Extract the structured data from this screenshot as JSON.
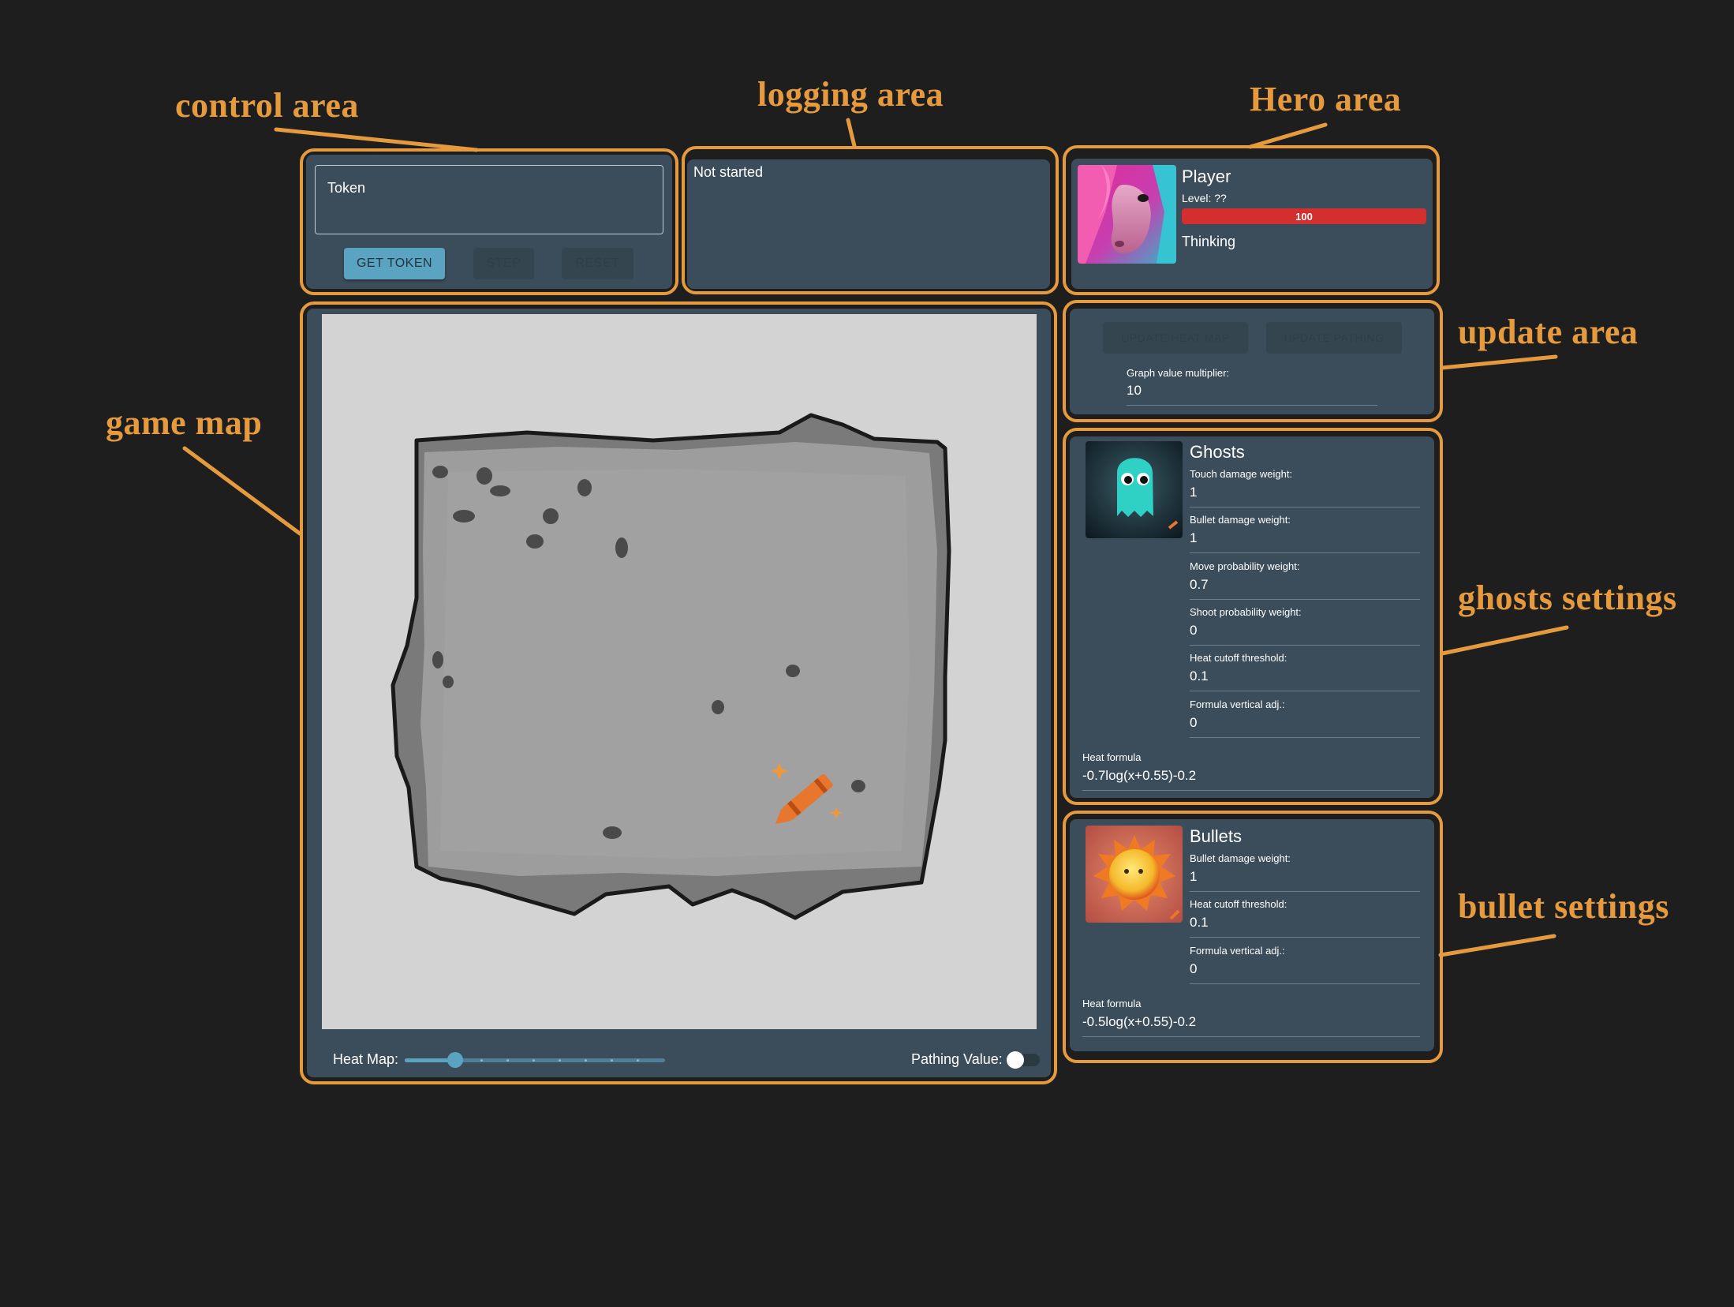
{
  "annotations": {
    "control_area": "control area",
    "logging_area": "logging area",
    "hero_area": "Hero area",
    "game_map": "game map",
    "update_area": "update area",
    "ghosts_settings": "ghosts settings",
    "bullet_settings": "bullet settings"
  },
  "controls": {
    "token_label": "Token",
    "get_token": "GET TOKEN",
    "step": "STEP",
    "reset": "RESET"
  },
  "log": {
    "status": "Not started"
  },
  "hero": {
    "name": "Player",
    "level": "Level: ??",
    "hp": "100",
    "status": "Thinking"
  },
  "update": {
    "update_heat_map": "UPDATE HEAT MAP",
    "update_pathing": "UPDATE PATHING",
    "multiplier_label": "Graph value multiplier:",
    "multiplier_value": "10"
  },
  "ghosts": {
    "title": "Ghosts",
    "fields": [
      {
        "label": "Touch damage weight:",
        "value": "1"
      },
      {
        "label": "Bullet damage weight:",
        "value": "1"
      },
      {
        "label": "Move probability weight:",
        "value": "0.7"
      },
      {
        "label": "Shoot probability weight:",
        "value": "0"
      },
      {
        "label": "Heat cutoff threshold:",
        "value": "0.1"
      },
      {
        "label": "Formula vertical adj.:",
        "value": "0"
      }
    ],
    "formula_label": "Heat formula",
    "formula_value": "-0.7log(x+0.55)-0.2"
  },
  "bullets": {
    "title": "Bullets",
    "fields": [
      {
        "label": "Bullet damage weight:",
        "value": "1"
      },
      {
        "label": "Heat cutoff threshold:",
        "value": "0.1"
      },
      {
        "label": "Formula vertical adj.:",
        "value": "0"
      }
    ],
    "formula_label": "Heat formula",
    "formula_value": "-0.5log(x+0.55)-0.2"
  },
  "map_footer": {
    "heat_map_label": "Heat Map:",
    "heat_map_level": 0.2,
    "pathing_label": "Pathing Value:",
    "pathing_on": false
  },
  "colors": {
    "background": "#1e1e1e",
    "panel": "#3b4d5a",
    "annotation": "#e59a3e",
    "accent": "#5aa4c2",
    "hp": "#d32f2f"
  },
  "icons": {
    "hero_avatar": "pink-horse-avatar",
    "ghost_avatar": "teal-ghost-avatar",
    "bullet_avatar": "fireball-avatar",
    "map_decoration": "crayon-icon"
  }
}
